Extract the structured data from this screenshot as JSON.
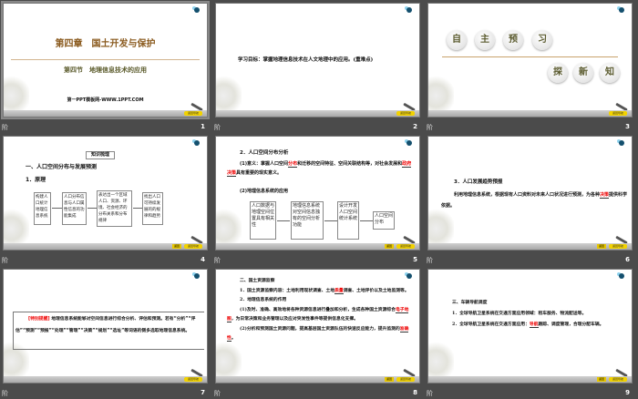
{
  "slides": [
    {
      "number": "1",
      "label": "阶",
      "chapter": "第四章　国土开发与保护",
      "section": "第四节　地理信息技术的应用",
      "site": "第一PPT模板网-WWW.1PPT.COM"
    },
    {
      "number": "2",
      "label": "阶",
      "goal": "学习目标：掌握地理信息技术在人文地理中的应用。(重难点)"
    },
    {
      "number": "3",
      "label": "阶",
      "row1": [
        "自",
        "主",
        "预",
        "习"
      ],
      "row2": [
        "探",
        "新",
        "知"
      ]
    },
    {
      "number": "4",
      "label": "阶",
      "tag": "知识梳理",
      "heading": "一、人口空间分布与发展预测",
      "sub": "1．原理",
      "boxes": [
        "构建人口统计地理信息系统",
        "人口分布信息与人口属性信息的功能集成",
        "表达出一个区域人口、资源、环境、社会经济的分布关系和分布规律",
        "找出人口可持续发展的的规律和趋势"
      ],
      "arrows": [
        "实现",
        "空间分析",
        "分析评价"
      ]
    },
    {
      "number": "5",
      "label": "阶",
      "heading": "2．人口空间分布分析",
      "p1a": "(1)意义：掌握人口空间",
      "blank1": "分布",
      "p1b": "和迁移的空间特征、空间关联结构等，对社会发展和",
      "blank2": "政府决策",
      "p1c": "具有重要的现实意义。",
      "p2": "(2)地理信息系统的应用",
      "boxes": [
        "人口数据与地理空间位置具有相关性",
        "地理信息系统对空间信息独有的空间分析功能",
        "设计开发人口空间统计系统",
        "人口空间分布"
      ],
      "arrows": [
        "利用",
        "",
        "分析"
      ]
    },
    {
      "number": "6",
      "label": "阶",
      "heading": "3．人口发展趋势预报",
      "p1": "利用地理信息系统，根据现有人口资料对未来人口状况进行预测，为各种",
      "blank": "决策",
      "p2": "提供科学依据。"
    },
    {
      "number": "7",
      "label": "阶",
      "tag": "[特别提醒]",
      "text": "地理信息系统能够对空间信息进行综合分析、评估和预测。若有“分析”“评估”“预测”“预报”“处理”“管理”“决策”“规划”“选址”等词语的侧多选取地理信息系统。"
    },
    {
      "number": "8",
      "label": "阶",
      "h1": "二、国土资源监察",
      "p1a": "1．国土资源监察内容：土地利用现状调查、土地",
      "blank1": "质量",
      "p1b": "调查、土地评价以及土地监测等。",
      "h2": "2．地理信息系统的作用",
      "p2a": "(1)及时、准确、高效地将各种资源信息进行叠加和分析，生成各种国土资源综合",
      "blank2": "电子地图",
      "p2b": "，为日常决策和业务管理以及应对突发性事件等提供信息化支撑。",
      "p3a": "(2)分析和预测国土资源问题，提高基层国土资源队伍的快速反应能力，提升监测的",
      "blank3": "准确性",
      "p3b": "。"
    },
    {
      "number": "9",
      "label": "阶",
      "h": "三、车辆导航调度",
      "p1": "1．全球导航卫星系统在交通方面应用领域：租车服务、物流配送等。",
      "p2a": "2．全球导航卫星系统在交通方面应用：",
      "blank": "导航",
      "p2b": "跟踪、调度管理，合理分配车辆。"
    }
  ],
  "footer_badge": "返回导航",
  "footer_back": "返回"
}
